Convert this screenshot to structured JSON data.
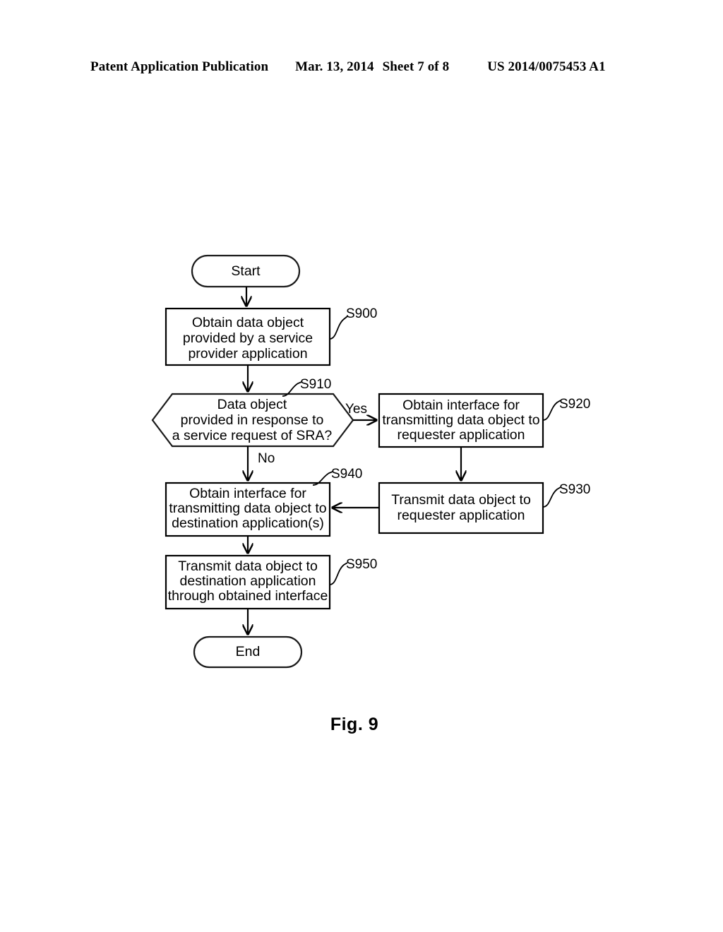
{
  "header": {
    "publication": "Patent Application Publication",
    "date": "Mar. 13, 2014",
    "sheet": "Sheet 7 of 8",
    "doc_number": "US 2014/0075453 A1"
  },
  "figure": {
    "caption": "Fig. 9",
    "nodes": {
      "start": {
        "label": "Start"
      },
      "s900": {
        "ref": "S900",
        "lines": [
          "Obtain data object",
          "provided by a service",
          "provider application"
        ]
      },
      "s910": {
        "ref": "S910",
        "lines": [
          "Data object",
          "provided in response to",
          "a service request of SRA?"
        ]
      },
      "s920": {
        "ref": "S920",
        "lines": [
          "Obtain interface for",
          "transmitting data object to",
          "requester application"
        ]
      },
      "s930": {
        "ref": "S930",
        "lines": [
          "Transmit data object to",
          "requester application"
        ]
      },
      "s940": {
        "ref": "S940",
        "lines": [
          "Obtain interface for",
          "transmitting data object to",
          "destination application(s)"
        ]
      },
      "s950": {
        "ref": "S950",
        "lines": [
          "Transmit data object to",
          "destination application",
          "through obtained interface"
        ]
      },
      "end": {
        "label": "End"
      }
    },
    "branches": {
      "yes": "Yes",
      "no": "No"
    },
    "colors": {
      "ink": "#000000",
      "paper": "#ffffff"
    }
  }
}
